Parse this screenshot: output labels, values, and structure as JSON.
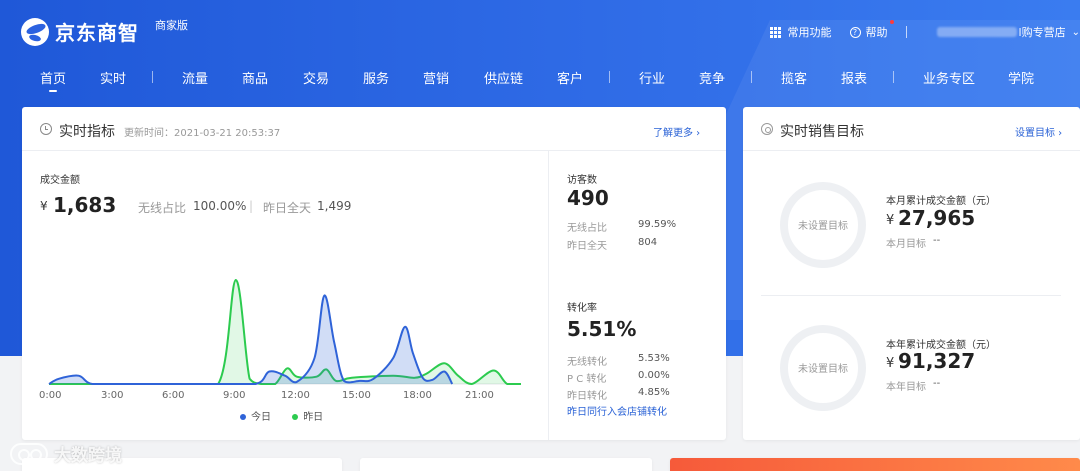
{
  "header": {
    "logo_text": "京东商智",
    "edition": "商家版",
    "common_functions": "常用功能",
    "help": "帮助",
    "store_suffix": "l购专营店"
  },
  "nav": {
    "items": [
      "首页",
      "实时",
      "流量",
      "商品",
      "交易",
      "服务",
      "营销",
      "供应链",
      "客户",
      "行业",
      "竞争",
      "揽客",
      "报表",
      "业务专区",
      "学院"
    ],
    "active": "首页"
  },
  "realtime": {
    "title": "实时指标",
    "update_label": "更新时间：",
    "update_time": "2021-03-21 20:53:37",
    "more_link": "了解更多",
    "gmv_label": "成交金额",
    "currency": "¥",
    "gmv_value": "1,683",
    "wireless_label": "无线占比",
    "wireless_value": "100.00%",
    "yesterday_label": "昨日全天",
    "yesterday_value": "1,499",
    "visitors": {
      "label": "访客数",
      "value": "490",
      "wireless_label": "无线占比",
      "wireless_value": "99.59%",
      "yesterday_label": "昨日全天",
      "yesterday_value": "804"
    },
    "conversion": {
      "label": "转化率",
      "value": "5.51%",
      "wireless_label": "无线转化",
      "wireless_value": "5.53%",
      "pc_label": "P C 转化",
      "pc_value": "0.00%",
      "yesterday_label": "昨日转化",
      "yesterday_value": "4.85%",
      "peer_link": "昨日同行入会店铺转化"
    },
    "legend_today": "今日",
    "legend_yesterday": "昨日",
    "colors": {
      "today": "#2f63d8",
      "yesterday": "#2ccb4f"
    }
  },
  "chart_data": {
    "type": "area",
    "x_ticks": [
      "0:00",
      "3:00",
      "6:00",
      "9:00",
      "12:00",
      "15:00",
      "18:00",
      "21:00"
    ],
    "x_range": [
      0,
      24
    ],
    "y_range": [
      0,
      100
    ],
    "series": [
      {
        "name": "今日",
        "points": [
          [
            0,
            0
          ],
          [
            0.5,
            5
          ],
          [
            1.5,
            8
          ],
          [
            2.2,
            0
          ],
          [
            4,
            0
          ],
          [
            6,
            0
          ],
          [
            8,
            0
          ],
          [
            10.5,
            0
          ],
          [
            11.2,
            12
          ],
          [
            12,
            8
          ],
          [
            12.6,
            2
          ],
          [
            13.5,
            25
          ],
          [
            14,
            85
          ],
          [
            14.5,
            40
          ],
          [
            15,
            3
          ],
          [
            15.8,
            3
          ],
          [
            16.5,
            5
          ],
          [
            17.5,
            25
          ],
          [
            18.1,
            55
          ],
          [
            18.5,
            30
          ],
          [
            19,
            6
          ],
          [
            19.5,
            4
          ],
          [
            20.1,
            12
          ],
          [
            20.5,
            0
          ]
        ]
      },
      {
        "name": "昨日",
        "points": [
          [
            0,
            0
          ],
          [
            3,
            0
          ],
          [
            6,
            0
          ],
          [
            8.6,
            0
          ],
          [
            9.5,
            100
          ],
          [
            10.2,
            5
          ],
          [
            10.8,
            0
          ],
          [
            11.5,
            0
          ],
          [
            12.1,
            15
          ],
          [
            12.6,
            7
          ],
          [
            13.6,
            7
          ],
          [
            14.1,
            14
          ],
          [
            14.6,
            3
          ],
          [
            15.4,
            6
          ],
          [
            17.5,
            8
          ],
          [
            18.6,
            6
          ],
          [
            19.2,
            10
          ],
          [
            20.1,
            20
          ],
          [
            20.8,
            8
          ],
          [
            21.5,
            0
          ],
          [
            22.6,
            13
          ],
          [
            23.3,
            0
          ],
          [
            24,
            0
          ]
        ]
      }
    ]
  },
  "sales_target": {
    "title": "实时销售目标",
    "set_link": "设置目标",
    "unset_label": "未设置目标",
    "monthly": {
      "label": "本月累计成交金额（元）",
      "currency": "¥",
      "value": "27,965",
      "target_label": "本月目标",
      "target_value": "--"
    },
    "yearly": {
      "label": "本年累计成交金额（元）",
      "currency": "¥",
      "value": "91,327",
      "target_label": "本年目标",
      "target_value": "--"
    }
  },
  "watermark": "大数跨境"
}
